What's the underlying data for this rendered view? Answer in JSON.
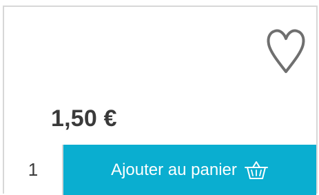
{
  "icons": {
    "favorite": "heart-outline",
    "basket": "basket-outline"
  },
  "product": {
    "price": "1,50 €"
  },
  "purchase": {
    "quantity": "1",
    "add_to_cart_label": "Ajouter au panier"
  },
  "colors": {
    "accent": "#0aaed0",
    "border": "#d7d7d7",
    "heart_stroke": "#6f6f6f",
    "text": "#3a3a3a"
  }
}
